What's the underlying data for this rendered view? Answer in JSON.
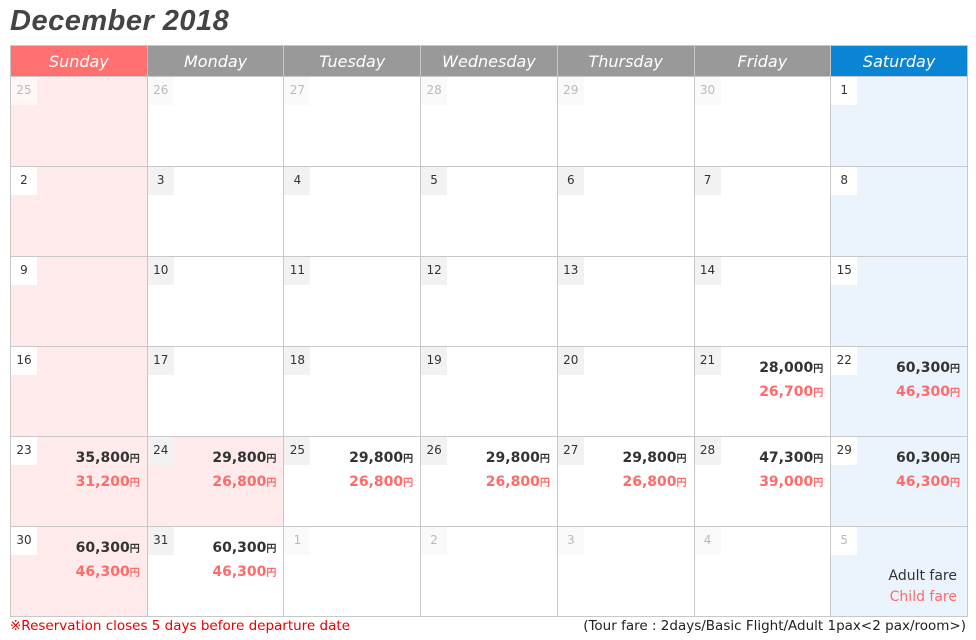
{
  "title": "December 2018",
  "currency_symbol": "円",
  "weekdays": [
    "Sunday",
    "Monday",
    "Tuesday",
    "Wednesday",
    "Thursday",
    "Friday",
    "Saturday"
  ],
  "colors": {
    "sunday_header": "#ff7070",
    "saturday_header": "#0a84d4",
    "weekday_header": "#999999",
    "adult_fare": "#333333",
    "child_fare": "#ff6b6b",
    "note": "#e60000"
  },
  "weeks": [
    [
      {
        "day": "25",
        "other": true
      },
      {
        "day": "26",
        "other": true
      },
      {
        "day": "27",
        "other": true
      },
      {
        "day": "28",
        "other": true
      },
      {
        "day": "29",
        "other": true
      },
      {
        "day": "30",
        "other": true
      },
      {
        "day": "1"
      }
    ],
    [
      {
        "day": "2"
      },
      {
        "day": "3"
      },
      {
        "day": "4"
      },
      {
        "day": "5"
      },
      {
        "day": "6"
      },
      {
        "day": "7"
      },
      {
        "day": "8"
      }
    ],
    [
      {
        "day": "9"
      },
      {
        "day": "10"
      },
      {
        "day": "11"
      },
      {
        "day": "12"
      },
      {
        "day": "13"
      },
      {
        "day": "14"
      },
      {
        "day": "15"
      }
    ],
    [
      {
        "day": "16"
      },
      {
        "day": "17"
      },
      {
        "day": "18"
      },
      {
        "day": "19"
      },
      {
        "day": "20"
      },
      {
        "day": "21",
        "adult": "28,000",
        "child": "26,700"
      },
      {
        "day": "22",
        "adult": "60,300",
        "child": "46,300"
      }
    ],
    [
      {
        "day": "23",
        "adult": "35,800",
        "child": "31,200"
      },
      {
        "day": "24",
        "adult": "29,800",
        "child": "26,800",
        "holiday": true
      },
      {
        "day": "25",
        "adult": "29,800",
        "child": "26,800"
      },
      {
        "day": "26",
        "adult": "29,800",
        "child": "26,800"
      },
      {
        "day": "27",
        "adult": "29,800",
        "child": "26,800"
      },
      {
        "day": "28",
        "adult": "47,300",
        "child": "39,000"
      },
      {
        "day": "29",
        "adult": "60,300",
        "child": "46,300"
      }
    ],
    [
      {
        "day": "30",
        "adult": "60,300",
        "child": "46,300"
      },
      {
        "day": "31",
        "adult": "60,300",
        "child": "46,300"
      },
      {
        "day": "1",
        "other": true
      },
      {
        "day": "2",
        "other": true
      },
      {
        "day": "3",
        "other": true
      },
      {
        "day": "4",
        "other": true
      },
      {
        "day": "5",
        "other": true,
        "legend": true
      }
    ]
  ],
  "legend": {
    "adult_label": "Adult fare",
    "child_label": "Child fare"
  },
  "footer": {
    "note": "※Reservation closes 5 days before departure date",
    "tour_info": "(Tour fare : 2days/Basic Flight/Adult 1pax<2 pax/room>)"
  }
}
